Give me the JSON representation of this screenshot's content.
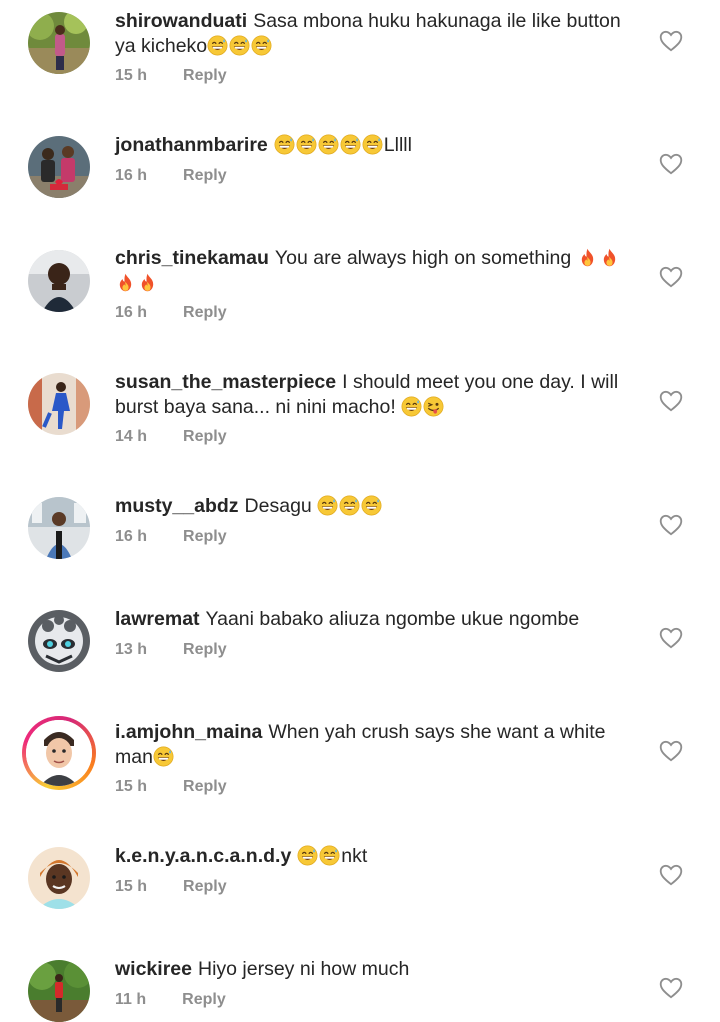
{
  "accent": "#ee2a7b",
  "meta_color": "#8e8e8e",
  "reply_label": "Reply",
  "comments": [
    {
      "username": "shirowanduati",
      "text": "Sasa mbona huku hakunaga ile like button ya kicheko",
      "emojis": [
        "grin-sweat-icon",
        "grin-sweat-icon",
        "grin-sweat-icon"
      ],
      "emoji_suffix": "",
      "time": "15 h"
    },
    {
      "username": "jonathanmbarire",
      "text": "",
      "emojis": [
        "grin-sweat-icon",
        "grin-sweat-icon",
        "grin-sweat-icon",
        "grin-sweat-icon",
        "grin-sweat-icon"
      ],
      "emoji_suffix": "Lllll",
      "time": "16 h"
    },
    {
      "username": "chris_tinekamau",
      "text": "You are always high on something ",
      "emojis": [
        "fire-icon",
        "fire-icon",
        "fire-icon",
        "fire-icon"
      ],
      "emoji_suffix": "",
      "time": "16 h"
    },
    {
      "username": "susan_the_masterpiece",
      "text": "I should meet you one day. I will burst baya sana... ni nini macho! ",
      "emojis": [
        "grin-sweat-icon",
        "winking-tongue-icon"
      ],
      "emoji_suffix": "",
      "time": "14 h"
    },
    {
      "username": "musty__abdz",
      "text": "Desagu ",
      "emojis": [
        "grin-sweat-icon",
        "grin-sweat-icon",
        "grin-sweat-icon"
      ],
      "emoji_suffix": "",
      "time": "16 h"
    },
    {
      "username": "lawremat",
      "text": "Yaani babako aliuza ngombe ukue ngombe",
      "emojis": [],
      "emoji_suffix": "",
      "time": "13 h"
    },
    {
      "username": "i.amjohn_maina",
      "text": "When yah crush says she want a white man",
      "emojis": [
        "grin-sweat-icon"
      ],
      "emoji_suffix": "",
      "time": "15 h"
    },
    {
      "username": "k.e.n.y.a.n.c.a.n.d.y",
      "text": "",
      "emojis": [
        "grin-sweat-icon",
        "grin-sweat-icon"
      ],
      "emoji_suffix": "nkt",
      "time": "15 h"
    },
    {
      "username": "wickiree",
      "text": "Hiyo jersey ni how much",
      "emojis": [],
      "emoji_suffix": "",
      "time": "11 h"
    }
  ]
}
